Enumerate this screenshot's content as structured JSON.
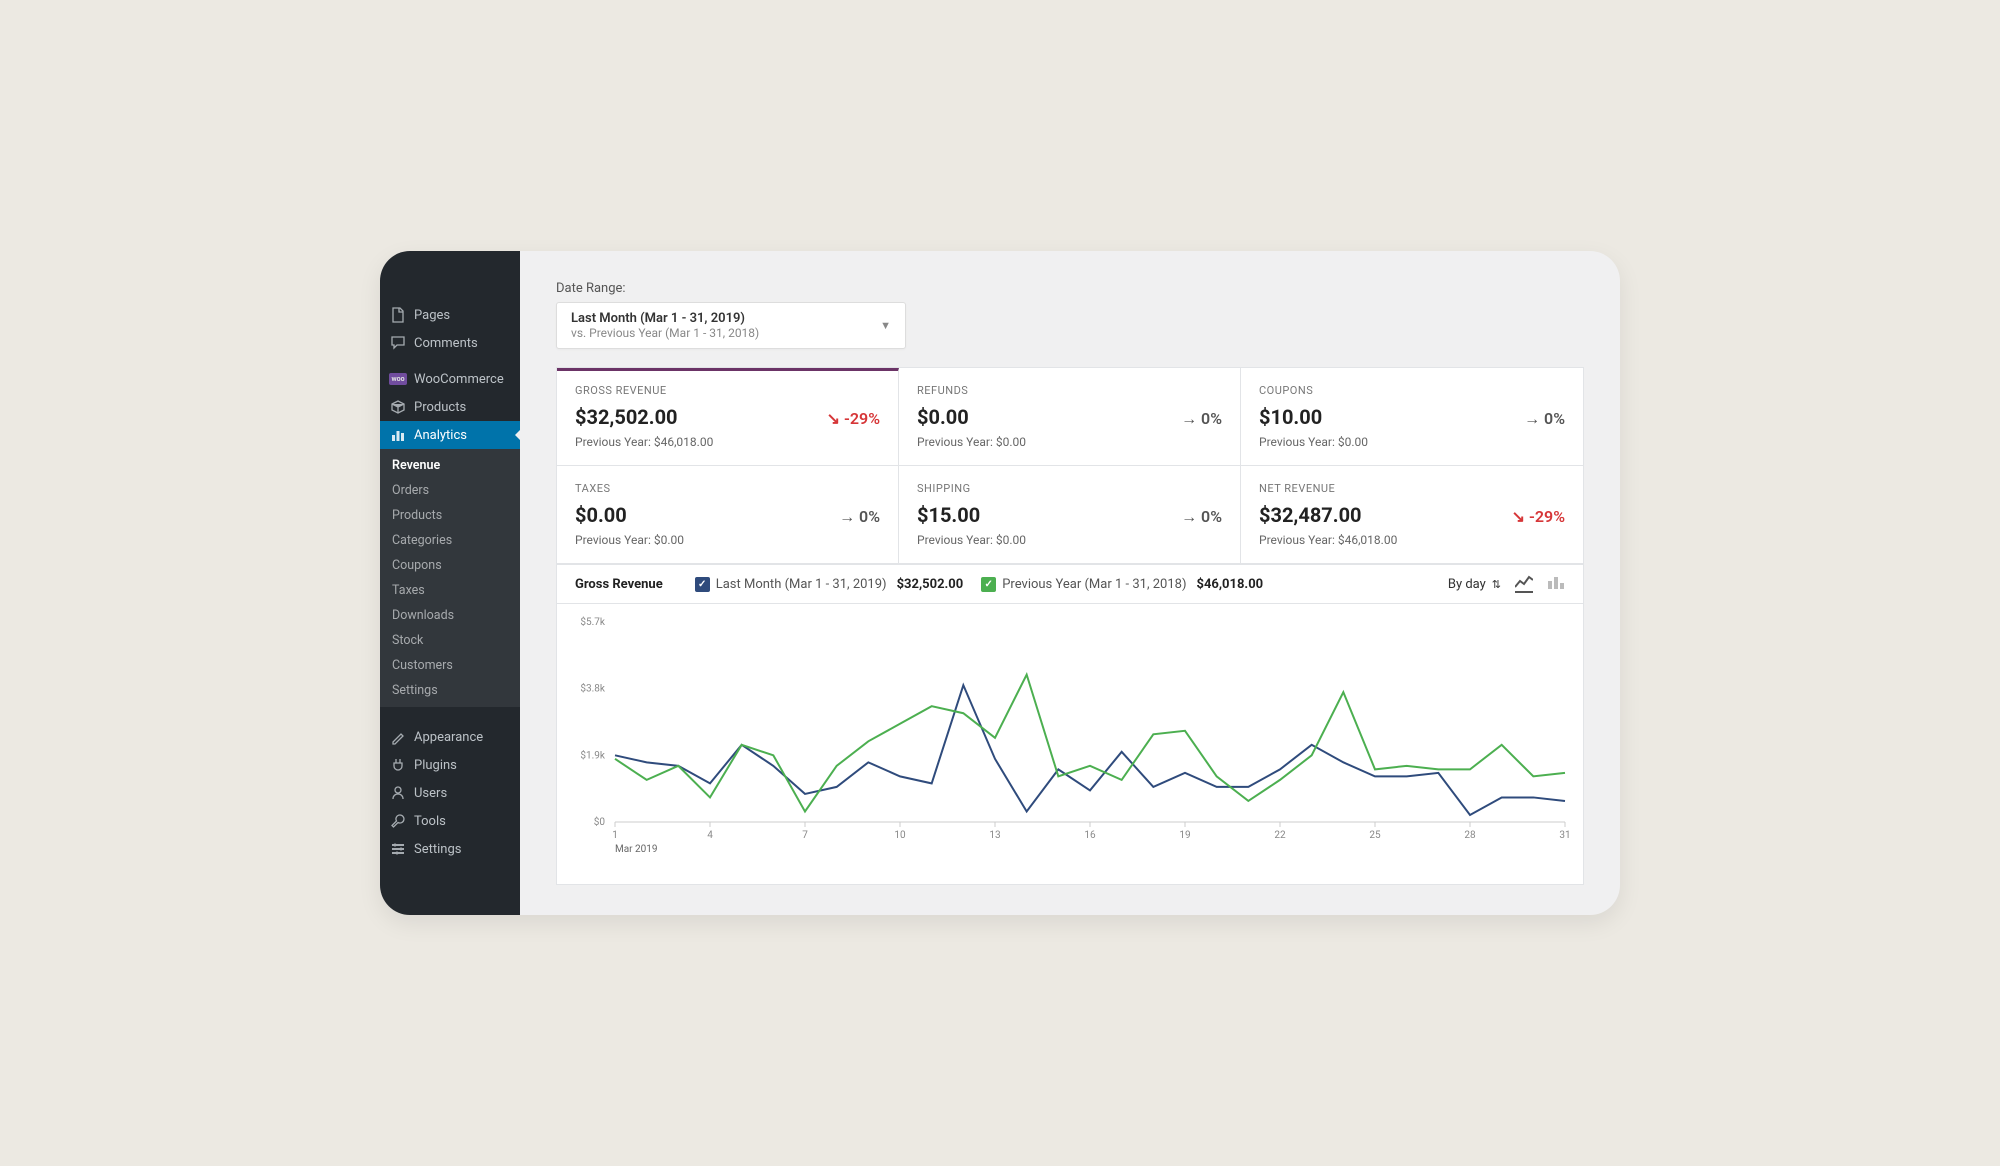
{
  "sidebar": {
    "items": [
      {
        "label": "Pages",
        "icon": "page-icon"
      },
      {
        "label": "Comments",
        "icon": "comment-icon"
      },
      {
        "label": "WooCommerce",
        "icon": "woo-icon"
      },
      {
        "label": "Products",
        "icon": "products-icon"
      },
      {
        "label": "Analytics",
        "icon": "analytics-icon",
        "active": true
      },
      {
        "label": "Appearance",
        "icon": "appearance-icon"
      },
      {
        "label": "Plugins",
        "icon": "plugins-icon"
      },
      {
        "label": "Users",
        "icon": "users-icon"
      },
      {
        "label": "Tools",
        "icon": "tools-icon"
      },
      {
        "label": "Settings",
        "icon": "settings-icon"
      }
    ],
    "sub_items": [
      {
        "label": "Revenue",
        "active": true
      },
      {
        "label": "Orders"
      },
      {
        "label": "Products"
      },
      {
        "label": "Categories"
      },
      {
        "label": "Coupons"
      },
      {
        "label": "Taxes"
      },
      {
        "label": "Downloads"
      },
      {
        "label": "Stock"
      },
      {
        "label": "Customers"
      },
      {
        "label": "Settings"
      }
    ]
  },
  "daterange": {
    "label": "Date Range:",
    "main": "Last Month (Mar 1 - 31, 2019)",
    "sub": "vs. Previous Year (Mar 1 - 31, 2018)"
  },
  "cards": [
    {
      "label": "GROSS REVENUE",
      "value": "$32,502.00",
      "delta": "↘ -29%",
      "dir": "down",
      "prev": "Previous Year: $46,018.00",
      "selected": true
    },
    {
      "label": "REFUNDS",
      "value": "$0.00",
      "delta": "→ 0%",
      "dir": "flat",
      "prev": "Previous Year: $0.00"
    },
    {
      "label": "COUPONS",
      "value": "$10.00",
      "delta": "→ 0%",
      "dir": "flat",
      "prev": "Previous Year: $0.00"
    },
    {
      "label": "TAXES",
      "value": "$0.00",
      "delta": "→ 0%",
      "dir": "flat",
      "prev": "Previous Year: $0.00"
    },
    {
      "label": "SHIPPING",
      "value": "$15.00",
      "delta": "→ 0%",
      "dir": "flat",
      "prev": "Previous Year: $0.00"
    },
    {
      "label": "NET REVENUE",
      "value": "$32,487.00",
      "delta": "↘ -29%",
      "dir": "down",
      "prev": "Previous Year: $46,018.00"
    }
  ],
  "chart_header": {
    "title": "Gross Revenue",
    "legend": [
      {
        "label": "Last Month (Mar 1 - 31, 2019)",
        "value": "$32,502.00",
        "color": "#2f4b7c"
      },
      {
        "label": "Previous Year (Mar 1 - 31, 2018)",
        "value": "$46,018.00",
        "color": "#4caf50"
      }
    ],
    "interval": "By day"
  },
  "chart_data": {
    "type": "line",
    "title": "Gross Revenue",
    "xlabel": "Mar 2019",
    "ylabel": "",
    "ylim": [
      0,
      5700
    ],
    "y_ticks": [
      "$0",
      "$1.9k",
      "$3.8k",
      "$5.7k"
    ],
    "x_ticks": [
      1,
      4,
      7,
      10,
      13,
      16,
      19,
      22,
      25,
      28,
      31
    ],
    "x": [
      1,
      2,
      3,
      4,
      5,
      6,
      7,
      8,
      9,
      10,
      11,
      12,
      13,
      14,
      15,
      16,
      17,
      18,
      19,
      20,
      21,
      22,
      23,
      24,
      25,
      26,
      27,
      28,
      29,
      30,
      31
    ],
    "series": [
      {
        "name": "Last Month (Mar 1 - 31, 2019)",
        "color": "#2f4b7c",
        "values": [
          1900,
          1700,
          1600,
          1100,
          2200,
          1600,
          800,
          1000,
          1700,
          1300,
          1100,
          3900,
          1800,
          300,
          1500,
          900,
          2000,
          1000,
          1400,
          1000,
          1000,
          1500,
          2200,
          1700,
          1300,
          1300,
          1400,
          200,
          700,
          700,
          600
        ]
      },
      {
        "name": "Previous Year (Mar 1 - 31, 2018)",
        "color": "#4caf50",
        "values": [
          1800,
          1200,
          1600,
          700,
          2200,
          1900,
          300,
          1600,
          2300,
          2800,
          3300,
          3100,
          2400,
          4200,
          1300,
          1600,
          1200,
          2500,
          2600,
          1300,
          600,
          1200,
          1900,
          3700,
          1500,
          1600,
          1500,
          1500,
          2200,
          1300,
          1400
        ]
      }
    ]
  }
}
